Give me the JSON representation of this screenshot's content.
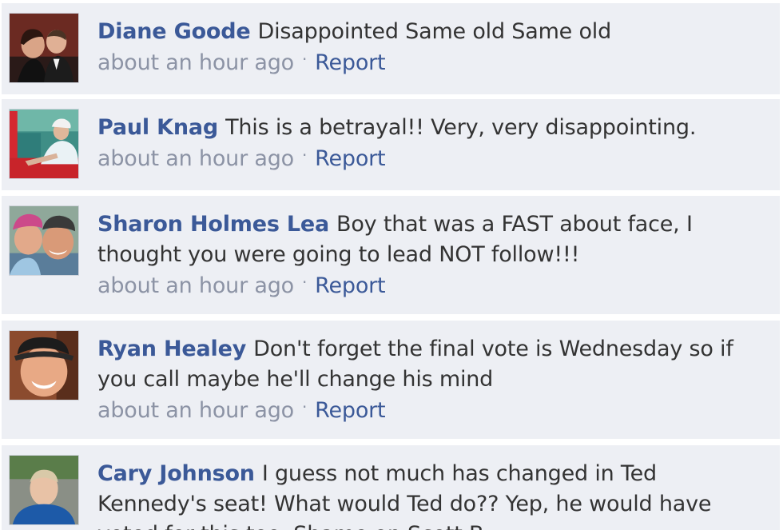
{
  "comments": [
    {
      "name": "Diane Goode",
      "text": "Disappointed Same old Same old",
      "time": "about an hour ago",
      "separator": "·",
      "report": "Report"
    },
    {
      "name": "Paul Knag",
      "text": "This is a betrayal!! Very, very disappointing.",
      "time": "about an hour ago",
      "separator": "·",
      "report": "Report"
    },
    {
      "name": "Sharon Holmes Lea",
      "text": "Boy that was a FAST about face, I thought you were going to lead NOT follow!!!",
      "time": "about an hour ago",
      "separator": "·",
      "report": "Report"
    },
    {
      "name": "Ryan Healey",
      "text": "Don't forget the final vote is Wednesday so if you call maybe he'll change his mind",
      "time": "about an hour ago",
      "separator": "·",
      "report": "Report"
    },
    {
      "name": "Cary Johnson",
      "text": "I guess not much has changed in Ted Kennedy's seat! What would Ted do?? Yep, he would have voted for this too. Shame on Scott B..",
      "time": null,
      "separator": null,
      "report": null
    }
  ],
  "colors": {
    "comment_bg": "#edeff4",
    "name_link": "#3b5998",
    "meta_text": "#8c93a5",
    "body_text": "#333333"
  }
}
